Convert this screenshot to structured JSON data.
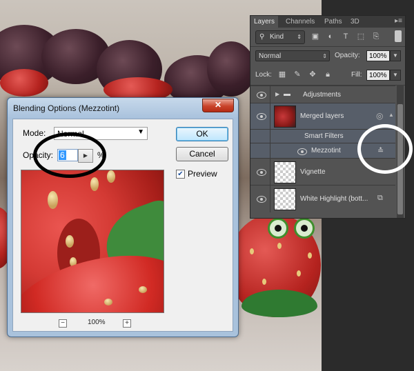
{
  "dialog": {
    "title": "Blending Options (Mezzotint)",
    "close_label": "✕",
    "mode_label": "Mode:",
    "mode_value": "Normal",
    "opacity_label": "Opacity:",
    "opacity_value": "6",
    "opacity_unit": "%",
    "ok_label": "OK",
    "cancel_label": "Cancel",
    "preview_label": "Preview",
    "preview_checked": true,
    "zoom_value": "100%"
  },
  "layers_panel": {
    "tabs": [
      "Layers",
      "Channels",
      "Paths",
      "3D"
    ],
    "active_tab": "Layers",
    "filter_kind": "Kind",
    "blend_mode": "Normal",
    "opacity_label": "Opacity:",
    "opacity_value": "100%",
    "lock_label": "Lock:",
    "fill_label": "Fill:",
    "fill_value": "100%",
    "layers": [
      {
        "name": "Adjustments",
        "type": "group"
      },
      {
        "name": "Merged layers",
        "type": "smart-object"
      },
      {
        "name": "Smart Filters",
        "type": "smart-filters-label"
      },
      {
        "name": "Mezzotint",
        "type": "filter"
      },
      {
        "name": "Vignette",
        "type": "layer"
      },
      {
        "name": "White Highlight (bott...",
        "type": "layer"
      }
    ]
  },
  "colors": {
    "panel_bg": "#535353",
    "dialog_frame": "#a9c2dc",
    "annotation_ring_dark": "#000000",
    "annotation_ring_light": "#ffffff"
  }
}
